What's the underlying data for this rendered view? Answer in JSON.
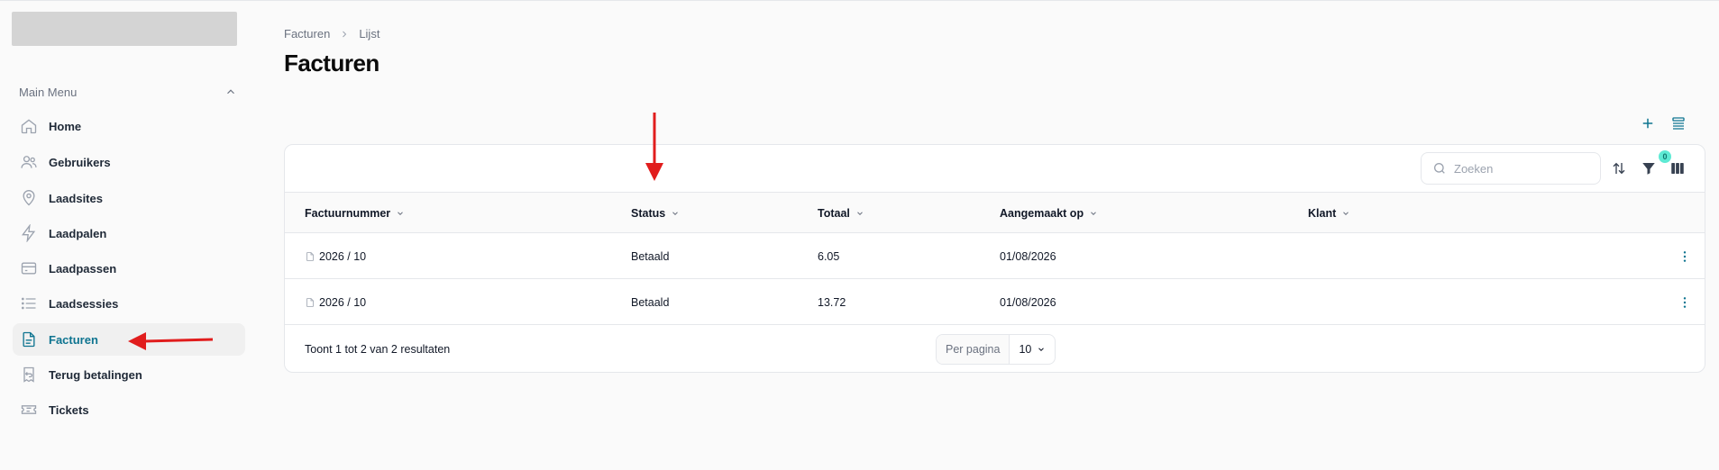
{
  "sidebar": {
    "menu_title": "Main Menu",
    "items": [
      {
        "label": "Home",
        "icon": "home-icon"
      },
      {
        "label": "Gebruikers",
        "icon": "users-icon"
      },
      {
        "label": "Laadsites",
        "icon": "map-pin-icon"
      },
      {
        "label": "Laadpalen",
        "icon": "bolt-icon"
      },
      {
        "label": "Laadpassen",
        "icon": "credit-card-icon"
      },
      {
        "label": "Laadsessies",
        "icon": "list-icon"
      },
      {
        "label": "Facturen",
        "icon": "document-icon",
        "active": true
      },
      {
        "label": "Terug betalingen",
        "icon": "refund-icon"
      },
      {
        "label": "Tickets",
        "icon": "ticket-icon"
      }
    ]
  },
  "breadcrumb": {
    "parent": "Facturen",
    "current": "Lijst"
  },
  "page": {
    "title": "Facturen"
  },
  "toolbar": {
    "search_placeholder": "Zoeken",
    "filter_count": "0"
  },
  "table": {
    "columns": [
      "Factuurnummer",
      "Status",
      "Totaal",
      "Aangemaakt op",
      "Klant"
    ],
    "rows": [
      {
        "number": "2026 / 10",
        "status": "Betaald",
        "total": "6.05",
        "created": "01/08/2026",
        "customer": ""
      },
      {
        "number": "2026 / 10",
        "status": "Betaald",
        "total": "13.72",
        "created": "01/08/2026",
        "customer": ""
      }
    ]
  },
  "footer": {
    "results": "Toont 1 tot 2 van 2 resultaten",
    "per_page_label": "Per pagina",
    "per_page_value": "10"
  },
  "colors": {
    "accent": "#0e7490",
    "annotation": "#e11d1d"
  }
}
